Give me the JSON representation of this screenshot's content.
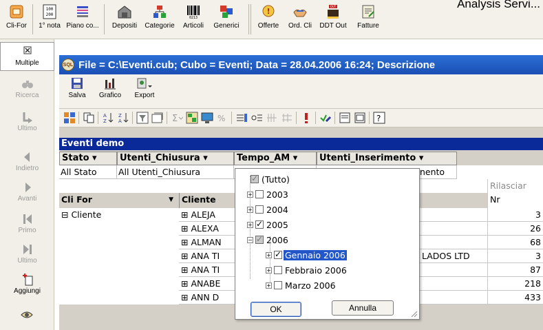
{
  "app": {
    "analysis_title": "Analysis Servi..."
  },
  "toolbar": {
    "items": [
      {
        "label": "Cli-For",
        "icon": "cli-for-icon"
      },
      {
        "label": "1° nota",
        "icon": "first-note-icon"
      },
      {
        "label": "Piano co...",
        "icon": "chart-of-accounts-icon"
      },
      {
        "label": "Depositi",
        "icon": "warehouse-icon"
      },
      {
        "label": "Categorie",
        "icon": "categories-icon"
      },
      {
        "label": "Articoli",
        "icon": "barcode-icon"
      },
      {
        "label": "Generici",
        "icon": "generic-items-icon"
      },
      {
        "label": "Offerte",
        "icon": "offers-icon"
      },
      {
        "label": "Ord. Cli",
        "icon": "customer-orders-icon"
      },
      {
        "label": "DDT Out",
        "icon": "ddt-out-icon"
      },
      {
        "label": "Fatture",
        "icon": "invoices-icon"
      }
    ]
  },
  "leftnav": {
    "items": [
      {
        "label": "Multiple",
        "icon": "multiple-icon",
        "state": "selected"
      },
      {
        "label": "Ricerca",
        "icon": "binoculars-icon",
        "state": "disabled"
      },
      {
        "label": "Ultimo",
        "icon": "last-record-icon",
        "state": "disabled"
      },
      {
        "label": "Indietro",
        "icon": "back-arrow-icon",
        "state": "disabled"
      },
      {
        "label": "Avanti",
        "icon": "forward-arrow-icon",
        "state": "disabled"
      },
      {
        "label": "Primo",
        "icon": "first-icon",
        "state": "disabled"
      },
      {
        "label": "Ultimo",
        "icon": "last-icon",
        "state": "disabled"
      },
      {
        "label": "Aggiungi",
        "icon": "add-icon",
        "state": "enabled"
      }
    ]
  },
  "window": {
    "title": "File = C:\\Eventi.cub; Cubo = Eventi; Data = 28.04.2006  16:24; Descrizione",
    "toolbar": {
      "save_label": "Salva",
      "chart_label": "Grafico",
      "export_label": "Export"
    }
  },
  "cube": {
    "title": "Eventi demo",
    "dimensions": [
      "Stato ▾",
      "Utenti_Chiusura ▾",
      "Tempo_AM ▾",
      "Utenti_Inserimento ▾"
    ],
    "all_values": [
      "All Stato",
      "All Utenti_Chiusura",
      "nento"
    ],
    "measure_header": "Rilasciar",
    "measure_sub": "Nr",
    "row_dim_header": "Cli For",
    "col_dim_header": "Cliente",
    "row_group": "⊟ Cliente",
    "rows": [
      {
        "client": "⊞ ALEJA",
        "value": "3"
      },
      {
        "client": "⊞ ALEXA",
        "value": "26"
      },
      {
        "client": "⊞ ALMAN",
        "value": "68"
      },
      {
        "client": "⊞ ANA TI",
        "extra": "LADOS LTD",
        "value": "3"
      },
      {
        "client": "⊞ ANA TI",
        "value": "87"
      },
      {
        "client": "⊞ ANABE",
        "value": "218"
      },
      {
        "client": "⊞ ANN D",
        "value": "433"
      }
    ]
  },
  "filter_popup": {
    "items": [
      {
        "label": "(Tutto)",
        "state": "partial"
      },
      {
        "label": "2003",
        "state": "unchecked"
      },
      {
        "label": "2004",
        "state": "unchecked"
      },
      {
        "label": "2005",
        "state": "checked"
      },
      {
        "label": "2006",
        "state": "partial"
      },
      {
        "label": "Gennaio 2006",
        "state": "checked"
      },
      {
        "label": "Febbraio 2006",
        "state": "unchecked"
      },
      {
        "label": "Marzo 2006",
        "state": "unchecked"
      }
    ],
    "ok_label": "OK",
    "cancel_label": "Annulla"
  },
  "colors": {
    "titlebar": "#1f5cc4",
    "cube_title": "#0a2a9a",
    "selection": "#2357c9"
  }
}
